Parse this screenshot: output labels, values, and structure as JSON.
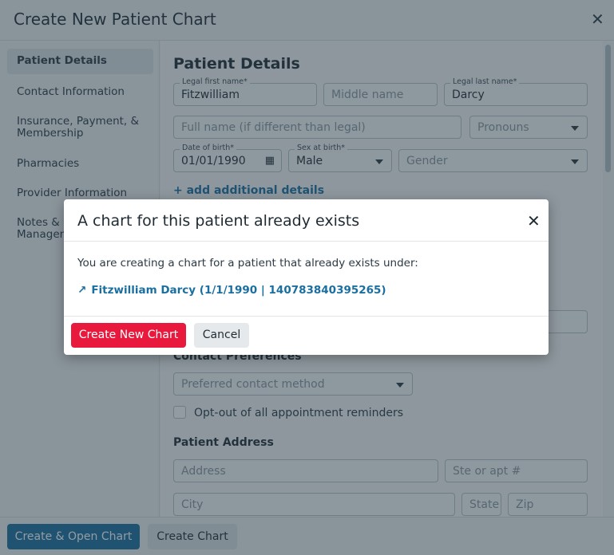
{
  "window": {
    "title": "Create New Patient Chart",
    "close_icon": "close-icon"
  },
  "sidebar": {
    "items": [
      {
        "label": "Patient Details",
        "active": true
      },
      {
        "label": "Contact Information"
      },
      {
        "label": "Insurance, Payment, & Membership"
      },
      {
        "label": "Pharmacies"
      },
      {
        "label": "Provider Information"
      },
      {
        "label": "Notes & Care Management"
      }
    ]
  },
  "form": {
    "title": "Patient Details",
    "first_name": {
      "label": "Legal first name*",
      "value": "Fitzwilliam"
    },
    "middle_name": {
      "placeholder": "Middle name"
    },
    "last_name": {
      "label": "Legal last name*",
      "value": "Darcy"
    },
    "full_name": {
      "placeholder": "Full name (if different than legal)"
    },
    "pronouns": {
      "placeholder": "Pronouns"
    },
    "dob": {
      "label": "Date of birth*",
      "value": "01/01/1990"
    },
    "sex": {
      "label": "Sex at birth*",
      "value": "Male"
    },
    "gender": {
      "placeholder": "Gender"
    },
    "add_details": "+ add additional details",
    "contact_preferences": "Contact Preferences",
    "preferred_contact": {
      "placeholder": "Preferred contact method"
    },
    "opt_out": {
      "label": "Opt-out of all appointment reminders",
      "checked": false
    },
    "address_title": "Patient Address",
    "address": {
      "placeholder": "Address"
    },
    "suite": {
      "placeholder": "Ste or apt #"
    },
    "city": {
      "placeholder": "City"
    },
    "state": {
      "placeholder": "State"
    },
    "zip": {
      "placeholder": "Zip"
    }
  },
  "footer": {
    "create_open": "Create & Open Chart",
    "create": "Create Chart"
  },
  "modal": {
    "title": "A chart for this patient already exists",
    "body": "You are creating a chart for a patient that already exists under:",
    "link": "Fitzwilliam Darcy (1/1/1990 | 140783840395265)",
    "create_new": "Create New Chart",
    "cancel": "Cancel"
  },
  "colors": {
    "primary": "#1a6fa0",
    "danger": "#e8193c"
  }
}
